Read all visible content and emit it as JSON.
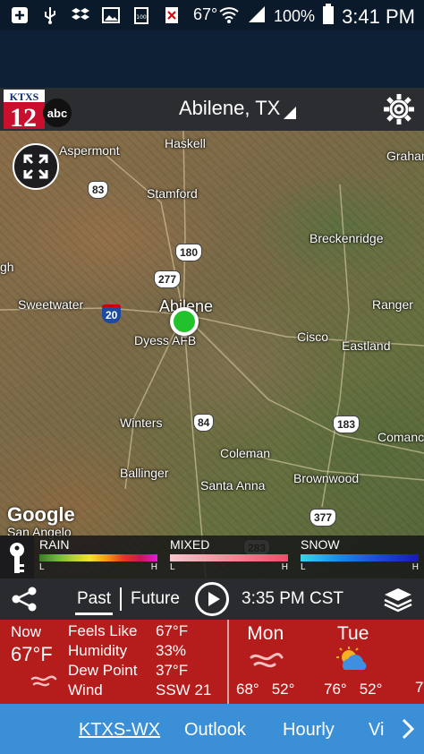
{
  "status_bar": {
    "icons": [
      "add-icon",
      "usb-icon",
      "dropbox-icon",
      "image-icon",
      "battery-100-icon",
      "close-icon"
    ],
    "left_temp": "67°",
    "battery_pct": "100%",
    "time": "3:41 PM"
  },
  "header": {
    "logo_top": "KTXS",
    "logo_num": "12",
    "logo_net": "abc",
    "location": "Abilene, TX"
  },
  "map": {
    "cities": {
      "aspermont": "Aspermont",
      "haskell": "Haskell",
      "graham": "Graham",
      "stamford": "Stamford",
      "breckenridge": "Breckenridge",
      "gh": "gh",
      "sweetwater": "Sweetwater",
      "abilene": "Abilene",
      "ranger": "Ranger",
      "dyess": "Dyess AFB",
      "cisco": "Cisco",
      "eastland": "Eastland",
      "winters": "Winters",
      "coleman": "Coleman",
      "comanche": "Comanc",
      "ballinger": "Ballinger",
      "brownwood": "Brownwood",
      "santa_anna": "Santa Anna",
      "san_angelo": "San Angelo"
    },
    "shields": {
      "us83": "83",
      "us180": "180",
      "us277": "277",
      "i20": "20",
      "us84": "84",
      "us183": "183",
      "us377": "377",
      "us283": "283"
    },
    "attribution": "Google"
  },
  "legend": {
    "rain": {
      "label": "RAIN",
      "low": "L",
      "high": "H"
    },
    "mixed": {
      "label": "MIXED",
      "low": "L",
      "high": "H"
    },
    "snow": {
      "label": "SNOW",
      "low": "L",
      "high": "H"
    }
  },
  "controls": {
    "past": "Past",
    "future": "Future",
    "time": "3:35 PM CST"
  },
  "weather": {
    "now_label": "Now",
    "now_temp": "67°F",
    "feels_like_label": "Feels Like",
    "feels_like": "67°F",
    "humidity_label": "Humidity",
    "humidity": "33%",
    "dew_point_label": "Dew Point",
    "dew_point": "37°F",
    "wind_label": "Wind",
    "wind": "SSW 21",
    "forecast": [
      {
        "day": "Mon",
        "high": "68°",
        "low": "52°",
        "icon": "wind-icon"
      },
      {
        "day": "Tue",
        "high": "76°",
        "low": "52°",
        "icon": "partly-cloudy-icon"
      }
    ],
    "partial_temp": "7"
  },
  "bottom_nav": {
    "items": [
      "KTXS-WX",
      "Outlook",
      "Hourly",
      "Vi"
    ]
  },
  "colors": {
    "header_bg": "#2c2d30",
    "weather_bg": "#b51c1c",
    "nav_bg": "#3a8fd6",
    "marker": "#21c22b"
  }
}
